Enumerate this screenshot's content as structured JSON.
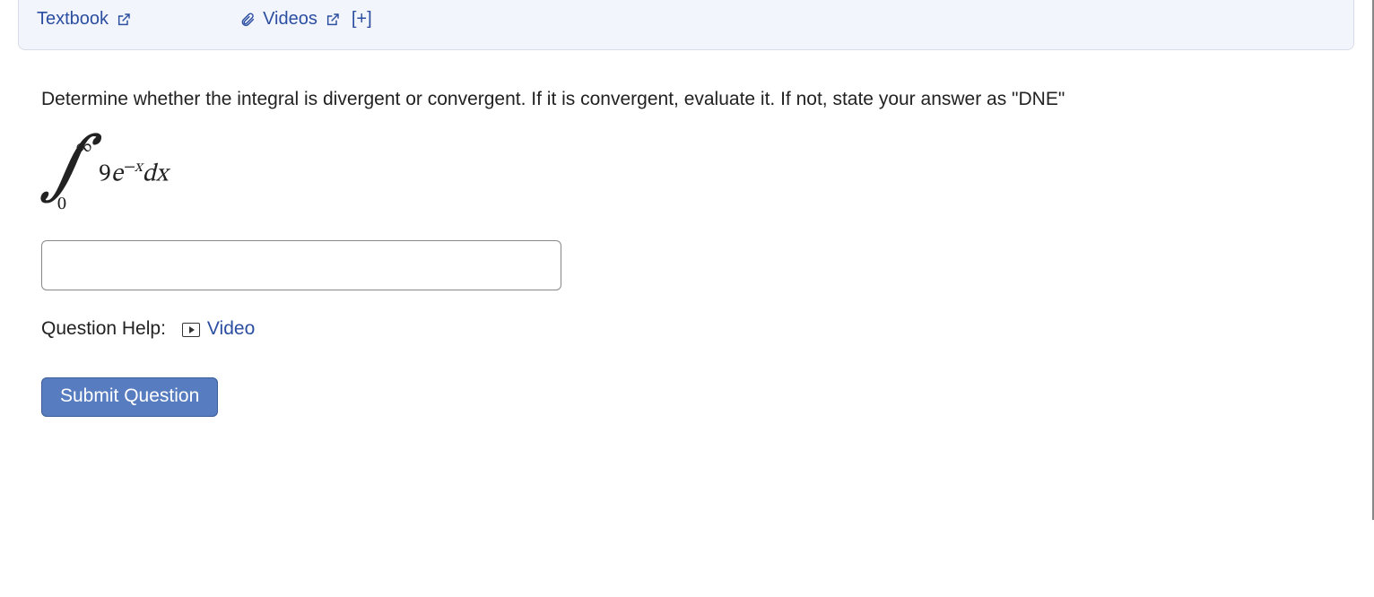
{
  "resources": {
    "textbook_label": "Textbook",
    "videos_label": "Videos",
    "expand_indicator": "[+]"
  },
  "question": {
    "prompt": "Determine whether the integral is divergent or convergent. If it is convergent, evaluate it. If not, state your answer as \"DNE\"",
    "integral": {
      "upper_limit": "∞",
      "lower_limit": "0",
      "coefficient": "9",
      "base": "e",
      "exponent": "−x",
      "differential": "dx"
    },
    "answer_value": ""
  },
  "help": {
    "label": "Question Help:",
    "video_label": "Video"
  },
  "submit_label": "Submit Question"
}
